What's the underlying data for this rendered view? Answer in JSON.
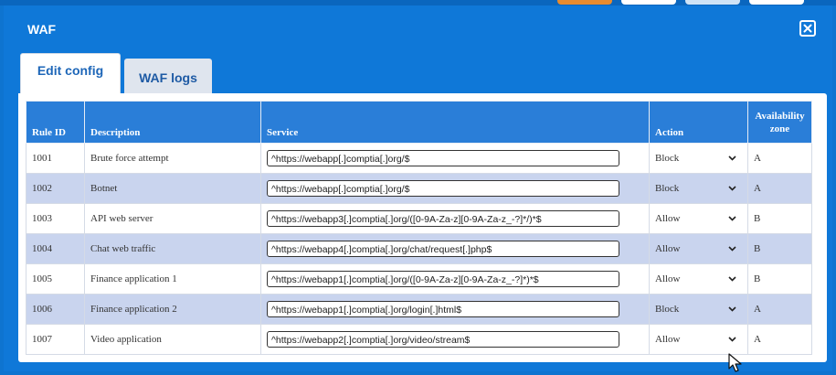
{
  "window": {
    "title": "WAF"
  },
  "tabs": [
    {
      "label": "Edit config",
      "active": true
    },
    {
      "label": "WAF logs",
      "active": false
    }
  ],
  "table": {
    "headers": {
      "rule_id": "Rule ID",
      "description": "Description",
      "service": "Service",
      "action": "Action",
      "zone": "Availability zone"
    },
    "rows": [
      {
        "rule_id": "1001",
        "description": "Brute force attempt",
        "service": "^https://webapp[.]comptia[.]org/$",
        "action": "Block",
        "zone": "A"
      },
      {
        "rule_id": "1002",
        "description": "Botnet",
        "service": "^https://webapp[.]comptia[.]org/$",
        "action": "Block",
        "zone": "A"
      },
      {
        "rule_id": "1003",
        "description": "API web server",
        "service": "^https://webapp3[.]comptia[.]org/([0-9A-Za-z][0-9A-Za-z_-?]*/)*$",
        "action": "Allow",
        "zone": "B"
      },
      {
        "rule_id": "1004",
        "description": "Chat web traffic",
        "service": "^https://webapp4[.]comptia[.]org/chat/request[.]php$",
        "action": "Allow",
        "zone": "B"
      },
      {
        "rule_id": "1005",
        "description": "Finance application 1",
        "service": "^https://webapp1[.]comptia[.]org/([0-9A-Za-z][0-9A-Za-z_-?]*)*$",
        "action": "Allow",
        "zone": "B"
      },
      {
        "rule_id": "1006",
        "description": "Finance application 2",
        "service": "^https://webapp1[.]comptia[.]org/login[.]html$",
        "action": "Block",
        "zone": "A"
      },
      {
        "rule_id": "1007",
        "description": "Video application",
        "service": "^https://webapp2[.]comptia[.]org/video/stream$",
        "action": "Allow",
        "zone": "A"
      }
    ]
  },
  "icons": {
    "close": "close-icon",
    "dropdown": "chevron-down-icon",
    "cursor": "mouse-pointer-icon"
  },
  "colors": {
    "dialog_bg": "#0f78d8",
    "header_bg": "#2a7ed8",
    "alt_row": "#c9d4ee",
    "tab_text": "#1d66b8"
  }
}
